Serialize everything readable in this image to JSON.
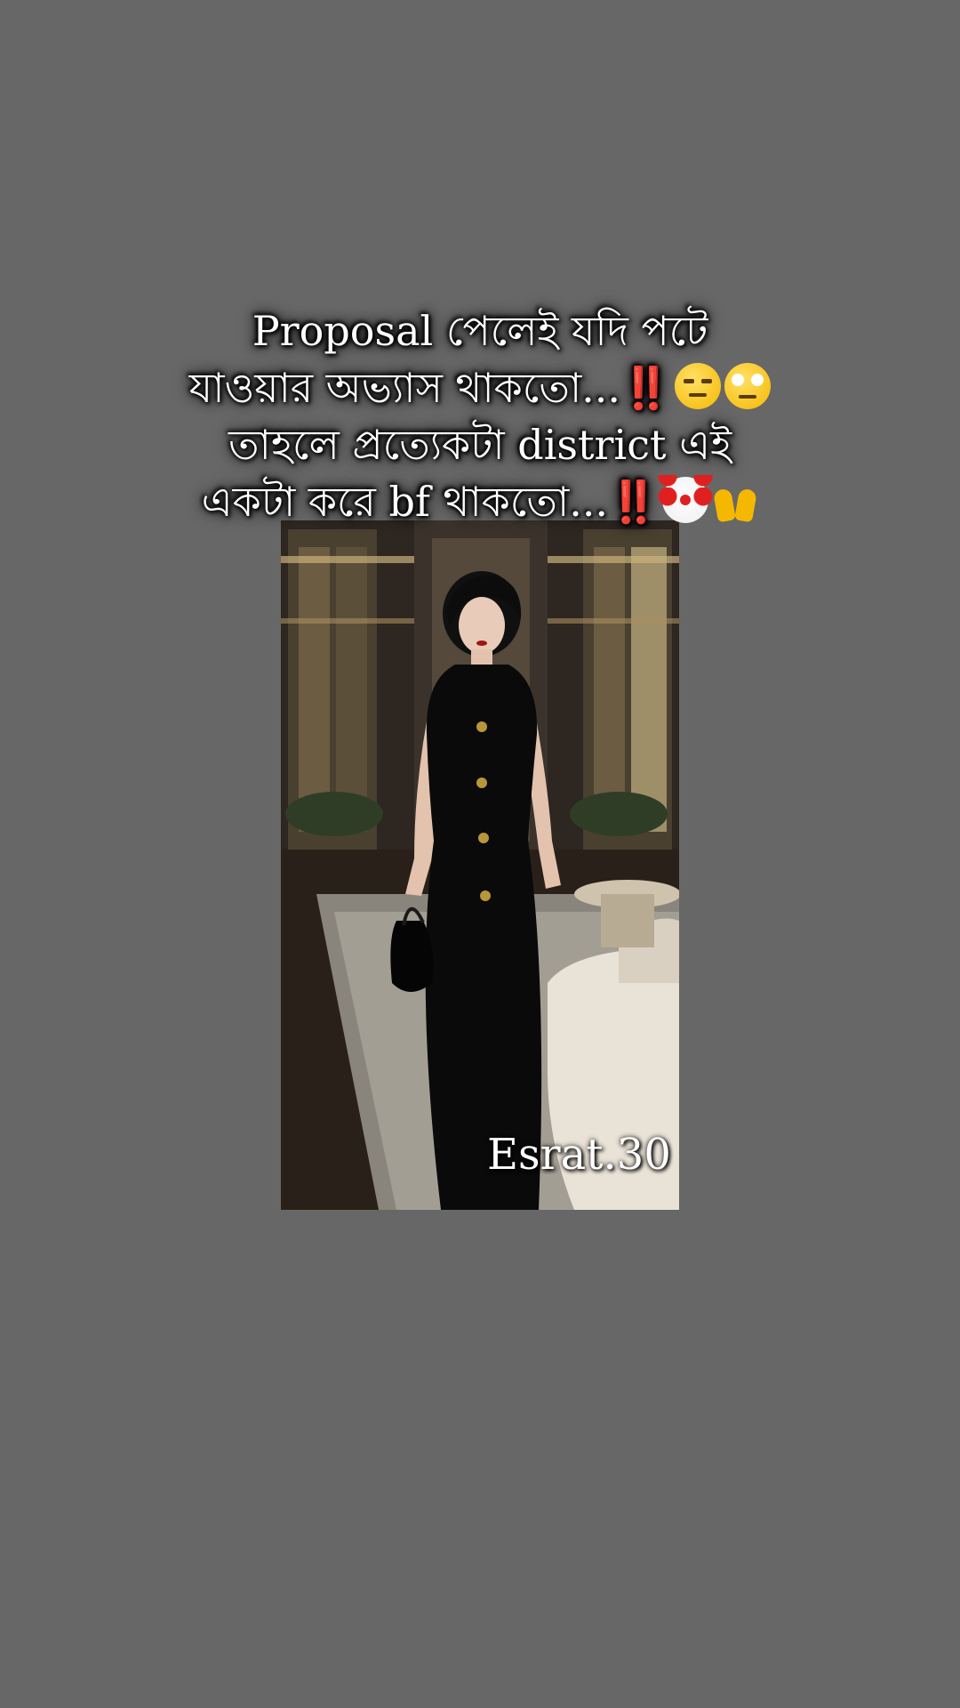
{
  "caption": {
    "line1": "Proposal পেলেই যদি পটে",
    "line2": "যাওয়ার অভ্যাস থাকতো...‼️",
    "line3": "তাহলে প্রত্যেকটা district এই",
    "line4": "একটা করে bf থাকতো...‼️"
  },
  "emojis": {
    "line2": [
      "unamused-face-icon",
      "face-with-rolling-eyes-icon"
    ],
    "line4": [
      "clown-face-icon",
      "raising-hands-icon"
    ]
  },
  "watermark": "Esrat.30",
  "colors": {
    "background": "#676767",
    "caption_text": "#ffffff"
  }
}
